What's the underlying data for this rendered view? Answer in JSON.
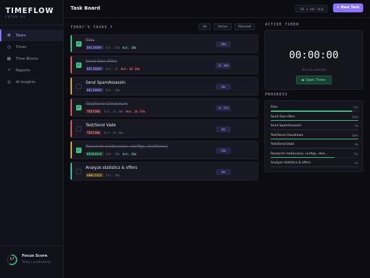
{
  "sidebar": {
    "logo": "TIMEFLOW",
    "logo_sub": "FOCUS OS",
    "items": [
      {
        "label": "Tasks",
        "icon": "grid-icon",
        "glyph": "⊞",
        "active": true
      },
      {
        "label": "Timer",
        "icon": "clock-icon",
        "glyph": "◷",
        "active": false
      },
      {
        "label": "Time Blocks",
        "icon": "calendar-icon",
        "glyph": "▦",
        "active": false
      },
      {
        "label": "Reports",
        "icon": "trend-icon",
        "glyph": "↗",
        "active": false
      },
      {
        "label": "AI Insights",
        "icon": "spark-icon",
        "glyph": "◎",
        "active": false
      }
    ],
    "focus": {
      "score": "57",
      "score_fraction": 0.57,
      "title": "Focus Score",
      "subtitle": "Today's productivity"
    }
  },
  "header": {
    "title": "Task Board",
    "date": "TUE 4 AUG 2026",
    "new_task_label": "+ New Task"
  },
  "tasks_section": {
    "title": "TODAY'S TASKS",
    "count": "7",
    "filters": [
      "All",
      "Active",
      "Planned"
    ]
  },
  "tasks": [
    {
      "title": "Files",
      "done": true,
      "bar_color": "#3ac17d",
      "tag": "DELIVERY",
      "tag_kind": "delivery",
      "est": "Est: 35m",
      "act": "Act: 28m",
      "act_color": "#5fd4a0",
      "time": "28m"
    },
    {
      "title": "Send Own-Filter",
      "done": true,
      "bar_color": "#e05a5a",
      "tag": "DELIVERY",
      "tag_kind": "delivery",
      "est": "Est: 2h",
      "act": "Act: 2h 15m",
      "act_color": "#ff6b6b",
      "time": "1h 10m"
    },
    {
      "title": "Send SpamAssassin",
      "done": false,
      "bar_color": "#d9a93c",
      "tag": "DELIVERY",
      "tag_kind": "delivery",
      "est": "Est: 30m",
      "act": "",
      "act_color": "#5fd4a0",
      "time": "0m"
    },
    {
      "title": "Test/Send Cloudmark",
      "done": true,
      "bar_color": "#e05a5a",
      "tag": "TESTING",
      "tag_kind": "testing",
      "est": "Est: 1h 30m",
      "act": "Act: 1h 37m",
      "act_color": "#ff6b6b",
      "time": "1h 37m"
    },
    {
      "title": "Test/Send Vade",
      "done": false,
      "bar_color": "#e05a5a",
      "tag": "TESTING",
      "tag_kind": "testing",
      "est": "Est: 1h 30m",
      "act": "",
      "act_color": "#5fd4a0",
      "time": "0m"
    },
    {
      "title": "Research (radiocasss, configs, shortlinks)",
      "done": true,
      "bar_color": "#d9a93c",
      "tag": "RESEARCH",
      "tag_kind": "research",
      "est": "Est: 30m",
      "act": "Act: 23m",
      "act_color": "#5fd4a0",
      "time": "23m"
    },
    {
      "title": "Analyze statistics & offers",
      "done": false,
      "bar_color": "#3ac1a8",
      "tag": "ANALYSIS",
      "tag_kind": "analysis",
      "est": "Est: 30m",
      "act": "",
      "act_color": "#5fd4a0",
      "time": "0m"
    }
  ],
  "timer": {
    "title": "ACTIVE TIMER",
    "display": "00:00:00",
    "subtitle": "No task selected",
    "button_label": "▶ Open Timer"
  },
  "progress": {
    "title": "PROGRESS",
    "rows": [
      {
        "name": "Files",
        "pct": "53%",
        "value": 0.93
      },
      {
        "name": "Send Own-Filter",
        "pct": "100%",
        "value": 1.0
      },
      {
        "name": "Send SpamAssassin",
        "pct": "0%",
        "value": 0.0
      },
      {
        "name": "Test/Send Cloudmark",
        "pct": "100%",
        "value": 1.0
      },
      {
        "name": "Test/Send Vade",
        "pct": "0%",
        "value": 0.0
      },
      {
        "name": "Research (radiocasss, configs, shor...",
        "pct": "73%",
        "value": 0.73
      },
      {
        "name": "Analyze statistics & offers",
        "pct": "0%",
        "value": 0.0
      }
    ]
  }
}
